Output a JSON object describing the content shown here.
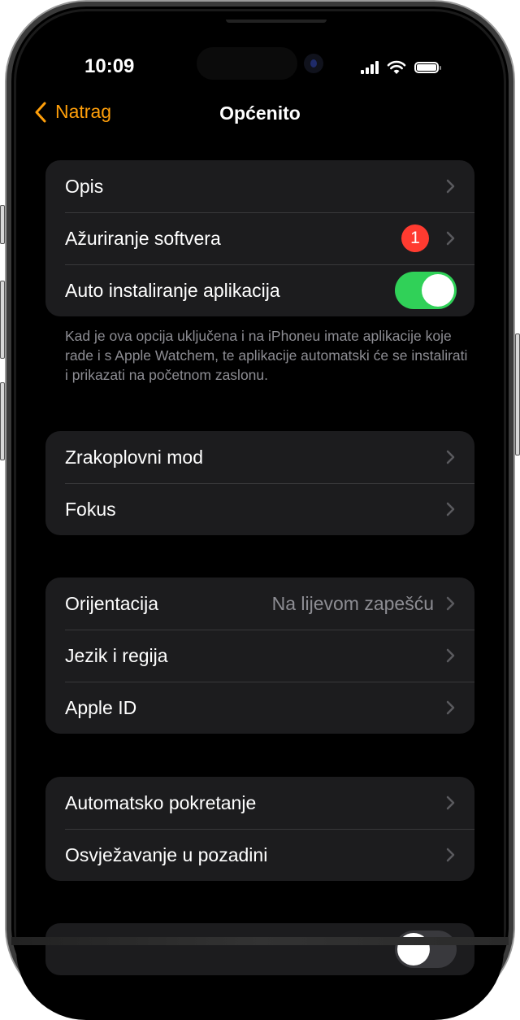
{
  "status_bar": {
    "time": "10:09",
    "icons": [
      "signal-icon",
      "wifi-icon",
      "battery-icon"
    ]
  },
  "nav": {
    "back_label": "Natrag",
    "title": "Općenito",
    "accent": "#ff9f0a"
  },
  "groups": [
    {
      "rows": [
        {
          "label": "Opis",
          "type": "chevron"
        },
        {
          "label": "Ažuriranje softvera",
          "type": "badge",
          "badge": "1"
        },
        {
          "label": "Auto instaliranje aplikacija",
          "type": "toggle",
          "on": true
        }
      ]
    },
    {
      "rows": [
        {
          "label": "Zrakoplovni mod",
          "type": "chevron"
        },
        {
          "label": "Fokus",
          "type": "chevron"
        }
      ]
    },
    {
      "rows": [
        {
          "label": "Orijentacija",
          "type": "value",
          "value": "Na lijevom zapešću"
        },
        {
          "label": "Jezik i regija",
          "type": "chevron"
        },
        {
          "label": "Apple ID",
          "type": "chevron"
        }
      ]
    },
    {
      "rows": [
        {
          "label": "Automatsko pokretanje",
          "type": "chevron"
        },
        {
          "label": "Osvježavanje u pozadini",
          "type": "chevron"
        }
      ]
    },
    {
      "rows": [
        {
          "label": "",
          "type": "toggle",
          "on": false
        }
      ]
    }
  ],
  "footnote": "Kad je ova opcija uključena i na iPhoneu imate aplikacije koje rade i s Apple Watchem, te aplikacije automatski će se instalirati i prikazati na početnom zaslonu.",
  "colors": {
    "toggle_on": "#30d158",
    "badge": "#ff3b30",
    "group_bg": "#1c1c1e",
    "secondary_text": "#8d8d93"
  }
}
